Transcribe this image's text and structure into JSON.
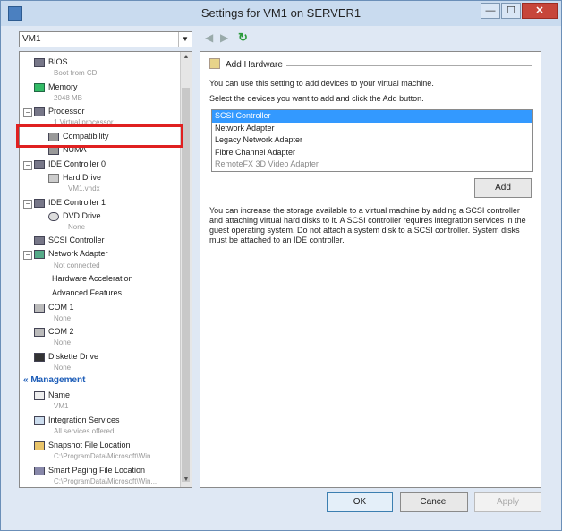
{
  "window": {
    "title": "Settings for VM1 on SERVER1",
    "minimize": "—",
    "maximize": "☐",
    "close": "✕"
  },
  "vm_selector": {
    "value": "VM1"
  },
  "tree": {
    "bios": {
      "label": "BIOS",
      "sub": "Boot from CD"
    },
    "memory": {
      "label": "Memory",
      "sub": "2048 MB"
    },
    "processor": {
      "label": "Processor",
      "sub": "1 Virtual processor"
    },
    "compatibility": {
      "label": "Compatibility"
    },
    "numa": {
      "label": "NUMA"
    },
    "ide0": {
      "label": "IDE Controller 0"
    },
    "hard_drive": {
      "label": "Hard Drive",
      "sub": "VM1.vhdx"
    },
    "ide1": {
      "label": "IDE Controller 1"
    },
    "dvd": {
      "label": "DVD Drive",
      "sub": "None"
    },
    "scsi": {
      "label": "SCSI Controller"
    },
    "network": {
      "label": "Network Adapter",
      "sub": "Not connected"
    },
    "hw_accel": {
      "label": "Hardware Acceleration"
    },
    "adv_features": {
      "label": "Advanced Features"
    },
    "com1": {
      "label": "COM 1",
      "sub": "None"
    },
    "com2": {
      "label": "COM 2",
      "sub": "None"
    },
    "diskette": {
      "label": "Diskette Drive",
      "sub": "None"
    },
    "management": {
      "label": "Management"
    },
    "name": {
      "label": "Name",
      "sub": "VM1"
    },
    "integration": {
      "label": "Integration Services",
      "sub": "All services offered"
    },
    "snapshot": {
      "label": "Snapshot File Location",
      "sub": "C:\\ProgramData\\Microsoft\\Win..."
    },
    "paging": {
      "label": "Smart Paging File Location",
      "sub": "C:\\ProgramData\\Microsoft\\Win..."
    }
  },
  "panel": {
    "title": "Add Hardware",
    "intro": "You can use this setting to add devices to your virtual machine.",
    "instruction": "Select the devices you want to add and click the Add button.",
    "devices": [
      "SCSI Controller",
      "Network Adapter",
      "Legacy Network Adapter",
      "Fibre Channel Adapter",
      "RemoteFX 3D Video Adapter"
    ],
    "add_label": "Add",
    "note": "You can increase the storage available to a virtual machine by adding a SCSI controller and attaching virtual hard disks to it. A SCSI controller requires integration services in the guest operating system. Do not attach a system disk to a SCSI controller. System disks must be attached to an IDE controller."
  },
  "buttons": {
    "ok": "OK",
    "cancel": "Cancel",
    "apply": "Apply"
  }
}
